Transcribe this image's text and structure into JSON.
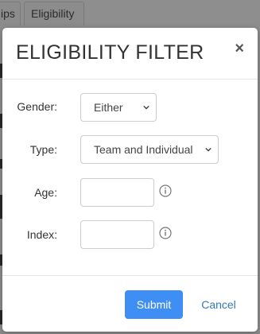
{
  "background": {
    "tabs": [
      "ips",
      "Eligibility"
    ]
  },
  "modal": {
    "title": "ELIGIBILITY FILTER",
    "close_label": "×",
    "fields": {
      "gender": {
        "label": "Gender:",
        "value": "Either"
      },
      "type": {
        "label": "Type:",
        "value": "Team and Individual"
      },
      "age": {
        "label": "Age:",
        "value": ""
      },
      "index": {
        "label": "Index:",
        "value": ""
      }
    },
    "submit_label": "Submit",
    "cancel_label": "Cancel"
  },
  "colors": {
    "primary": "#3f8ef3",
    "link": "#337ab7",
    "overlay": "#8e8e8e"
  }
}
